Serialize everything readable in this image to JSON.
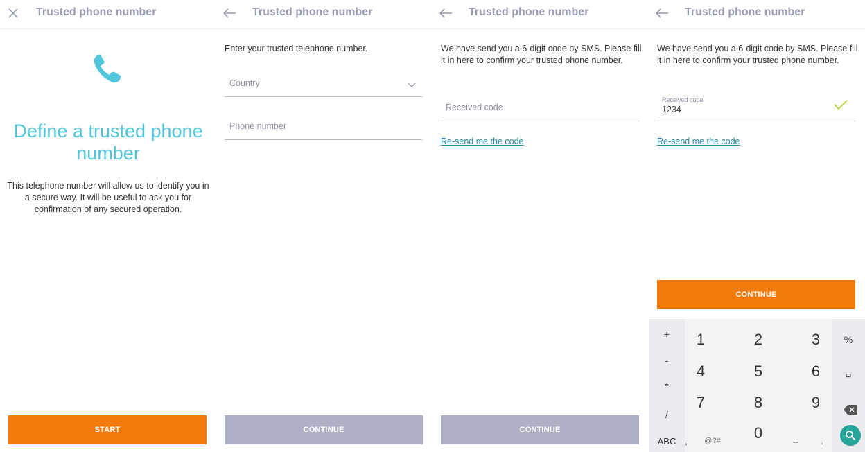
{
  "colors": {
    "accent_orange": "#f27a0c",
    "disabled_grey": "#aeb0c6",
    "title_teal": "#4fc6dc",
    "link_teal": "#1a8aa8",
    "check_green": "#b5d334",
    "header_text": "#9a9cb4"
  },
  "screens": [
    {
      "nav_icon": "close-icon",
      "title": "Trusted phone number",
      "hero_icon": "phone-icon",
      "hero_title": "Define a trusted phone number",
      "description": "This telephone number will allow us to identify you in a secure way. It will be useful to ask you for confirmation of any secured operation.",
      "button_label": "START"
    },
    {
      "nav_icon": "back-arrow-icon",
      "title": "Trusted phone number",
      "instruction": "Enter your trusted telephone number.",
      "country_placeholder": "Country",
      "phone_placeholder": "Phone number",
      "button_label": "CONTINUE"
    },
    {
      "nav_icon": "back-arrow-icon",
      "title": "Trusted phone number",
      "instruction": "We have send you a 6-digit code by SMS. Please fill it in here to confirm your trusted phone number.",
      "code_placeholder": "Received code",
      "resend_link": "Re-send me the code",
      "button_label": "CONTINUE"
    },
    {
      "nav_icon": "back-arrow-icon",
      "title": "Trusted phone number",
      "instruction": "We have send you a 6-digit code by SMS. Please fill it in here to confirm your trusted phone number.",
      "code_label": "Received code",
      "code_value": "1234",
      "resend_link": "Re-send me the code",
      "button_label": "CONTINUE",
      "keyboard": {
        "left_keys": [
          "+",
          "-",
          "*",
          "/"
        ],
        "digits": [
          "1",
          "2",
          "3",
          "4",
          "5",
          "6",
          "7",
          "8",
          "9",
          "0"
        ],
        "right_keys": [
          "%",
          "␣"
        ],
        "bottom_keys": [
          "ABC",
          ",",
          "@?#",
          "=",
          "."
        ]
      }
    }
  ]
}
